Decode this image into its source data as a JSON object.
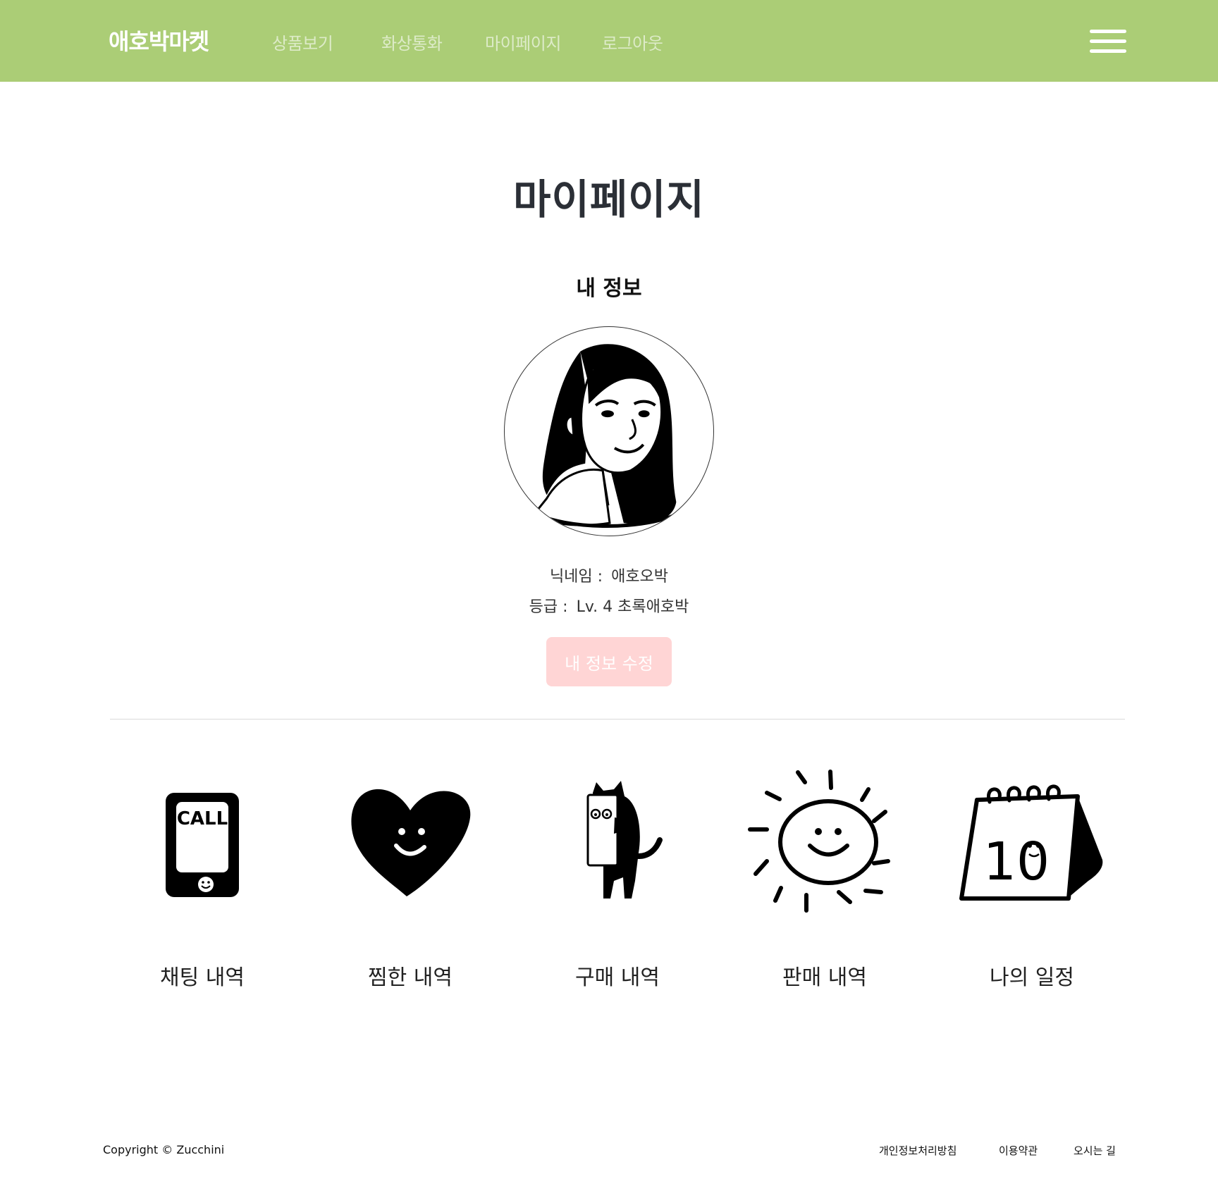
{
  "navbar": {
    "brand": "애호박마켓",
    "links": [
      "상품보기",
      "화상통화",
      "마이페이지",
      "로그아웃"
    ],
    "menu_icon": "hamburger-icon",
    "background_color": "#abcd76"
  },
  "main": {
    "title": "마이페이지",
    "section_title": "내 정보",
    "avatar_icon": "user-avatar-illustration",
    "nickname_label": "닉네임 :",
    "nickname_value": "애호오박",
    "grade_label": "등급 :",
    "grade_value": "Lv. 4 초록애호박",
    "edit_button": "내 정보 수정",
    "edit_button_color": "#ffd5d5"
  },
  "menu": [
    {
      "label": "채팅 내역",
      "icon": "phone-call-icon"
    },
    {
      "label": "찜한 내역",
      "icon": "heart-icon"
    },
    {
      "label": "구매 내역",
      "icon": "cat-shopping-icon"
    },
    {
      "label": "판매 내역",
      "icon": "sun-icon"
    },
    {
      "label": "나의 일정",
      "icon": "calendar-icon",
      "calendar_text": "10"
    }
  ],
  "footer": {
    "copyright": "Copyright © Zucchini",
    "links": [
      "개인정보처리방침",
      "이용약관",
      "오시는 길"
    ]
  }
}
